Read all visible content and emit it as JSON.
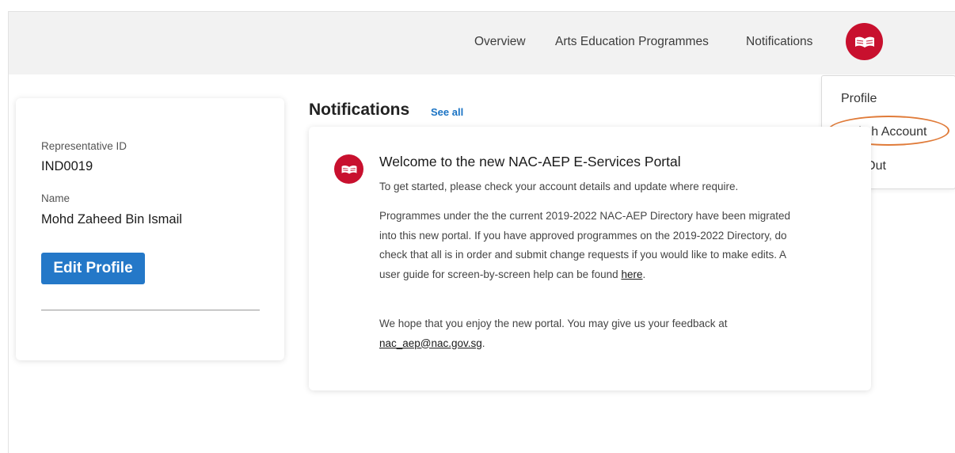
{
  "nav": {
    "links": [
      "Overview",
      "Arts Education Programmes",
      "Notifications"
    ],
    "avatar_icon": "book-logo-icon",
    "brand_color": "#c8102e"
  },
  "account_menu": {
    "items": [
      "Profile",
      "Switch Account",
      "Log Out"
    ],
    "highlighted": "Switch Account",
    "highlight_color": "#e07b39"
  },
  "profile": {
    "rep_id_label": "Representative ID",
    "rep_id": "IND0019",
    "name_label": "Name",
    "name": "Mohd Zaheed Bin Ismail",
    "edit_button": "Edit Profile",
    "button_color": "#2478c8"
  },
  "notifications": {
    "heading": "Notifications",
    "see_all": "See all",
    "items": [
      {
        "icon": "book-logo-icon",
        "title": "Welcome to the new NAC-AEP E-Services Portal",
        "subtitle": "To get started, please check your account details and update where require.",
        "para1": "Programmes under the the current 2019-2022 NAC-AEP Directory have been migrated into this new portal. If you have approved programmes on the 2019-2022 Directory, do check that all is in order and submit change requests if you would like to make edits. A user guide for screen-by-screen help can be found ",
        "para1_link": "here",
        "para1_end": ".",
        "para2": "We hope that you enjoy the new portal. You may give us your feedback at ",
        "para2_link": "nac_aep@nac.gov.sg",
        "para2_end": "."
      }
    ]
  }
}
